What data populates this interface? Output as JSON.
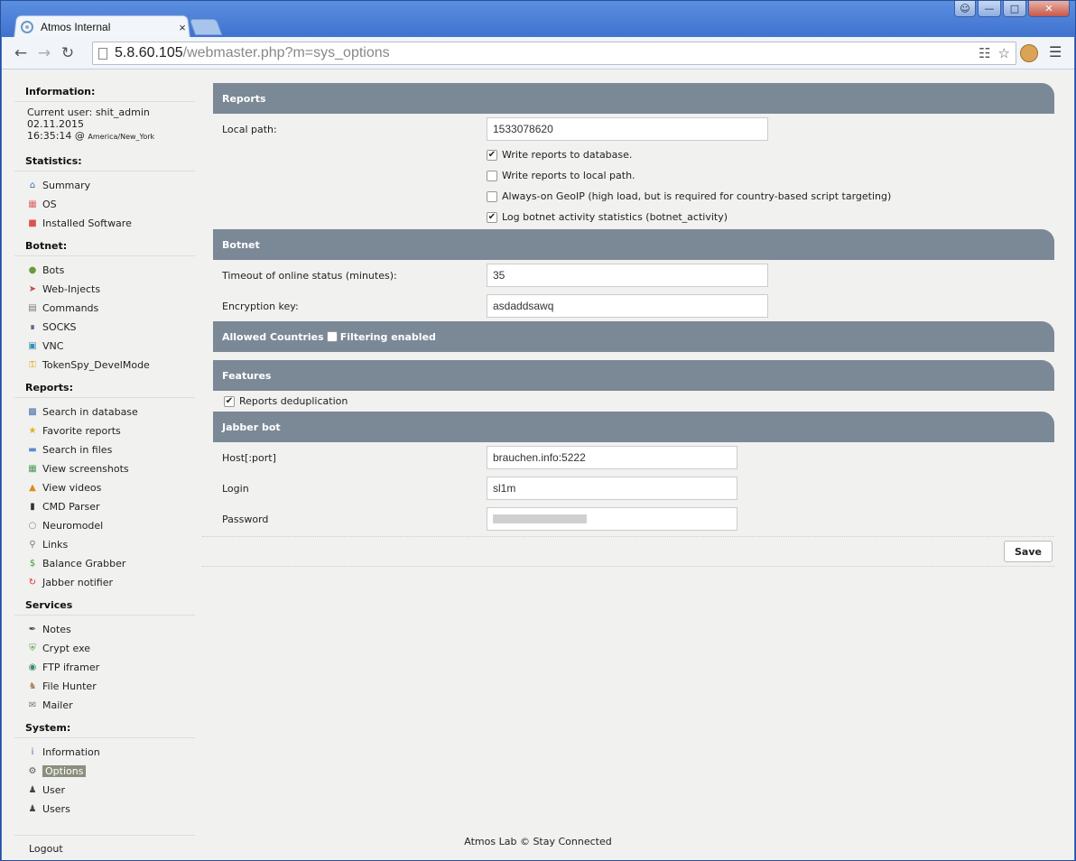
{
  "browser": {
    "tab_title": "Atmos Internal",
    "tab_close": "×",
    "url_host": "5.8.60.105",
    "url_path": "/webmaster.php?m=sys_options"
  },
  "sidebar": {
    "information_heading": "Information:",
    "current_user": "Current user: shit_admin",
    "date": "02.11.2015",
    "time": "16:35:14 @",
    "timezone": "America/New_York",
    "statistics_heading": "Statistics:",
    "statistics": [
      {
        "label": "Summary",
        "icon": "home-icon"
      },
      {
        "label": "OS",
        "icon": "windows-icon"
      },
      {
        "label": "Installed Software",
        "icon": "software-icon"
      }
    ],
    "botnet_heading": "Botnet:",
    "botnet": [
      {
        "label": "Bots",
        "icon": "bot-icon"
      },
      {
        "label": "Web-Injects",
        "icon": "inject-icon"
      },
      {
        "label": "Commands",
        "icon": "commands-icon"
      },
      {
        "label": "SOCKS",
        "icon": "socks-icon"
      },
      {
        "label": "VNC",
        "icon": "vnc-icon"
      },
      {
        "label": "TokenSpy_DevelMode",
        "icon": "key-icon"
      }
    ],
    "reports_heading": "Reports:",
    "reports": [
      {
        "label": "Search in database",
        "icon": "database-icon"
      },
      {
        "label": "Favorite reports",
        "icon": "star-icon"
      },
      {
        "label": "Search in files",
        "icon": "folder-icon"
      },
      {
        "label": "View screenshots",
        "icon": "screenshot-icon"
      },
      {
        "label": "View videos",
        "icon": "video-icon"
      },
      {
        "label": "CMD Parser",
        "icon": "cmd-icon"
      },
      {
        "label": "Neuromodel",
        "icon": "neuro-icon"
      },
      {
        "label": "Links",
        "icon": "links-icon"
      },
      {
        "label": "Balance Grabber",
        "icon": "dollar-icon"
      },
      {
        "label": "Jabber notifier",
        "icon": "jabber-icon"
      }
    ],
    "services_heading": "Services",
    "services": [
      {
        "label": "Notes",
        "icon": "pen-icon"
      },
      {
        "label": "Crypt exe",
        "icon": "shield-icon"
      },
      {
        "label": "FTP iframer",
        "icon": "globe-icon"
      },
      {
        "label": "File Hunter",
        "icon": "hunter-icon"
      },
      {
        "label": "Mailer",
        "icon": "mail-icon"
      }
    ],
    "system_heading": "System:",
    "system": [
      {
        "label": "Information",
        "icon": "info-icon"
      },
      {
        "label": "Options",
        "icon": "options-icon",
        "active": true
      },
      {
        "label": "User",
        "icon": "user-icon"
      },
      {
        "label": "Users",
        "icon": "users-icon"
      }
    ],
    "logout": "Logout"
  },
  "reports_panel": {
    "title": "Reports",
    "local_path_label": "Local path:",
    "local_path_value": "1533078620",
    "checkboxes": [
      {
        "label": "Write reports to database.",
        "checked": true
      },
      {
        "label": "Write reports to local path.",
        "checked": false
      },
      {
        "label": "Always-on GeoIP (high load, but is required for country-based script targeting)",
        "checked": false
      },
      {
        "label": "Log botnet activity statistics (botnet_activity)",
        "checked": true
      }
    ]
  },
  "botnet_panel": {
    "title": "Botnet",
    "timeout_label": "Timeout of online status (minutes):",
    "timeout_value": "35",
    "encryption_label": "Encryption key:",
    "encryption_value": "asdaddsawq"
  },
  "countries_panel": {
    "title": "Allowed Countries",
    "filtering_label": "Filtering enabled",
    "filtering_checked": false
  },
  "features_panel": {
    "title": "Features",
    "dedup_label": "Reports deduplication",
    "dedup_checked": true
  },
  "jabber_panel": {
    "title": "Jabber bot",
    "host_label": "Host[:port]",
    "host_value": "brauchen.info:5222",
    "login_label": "Login",
    "login_value": "sl1m",
    "password_label": "Password"
  },
  "save_label": "Save",
  "footer": "Atmos Lab © Stay Connected"
}
